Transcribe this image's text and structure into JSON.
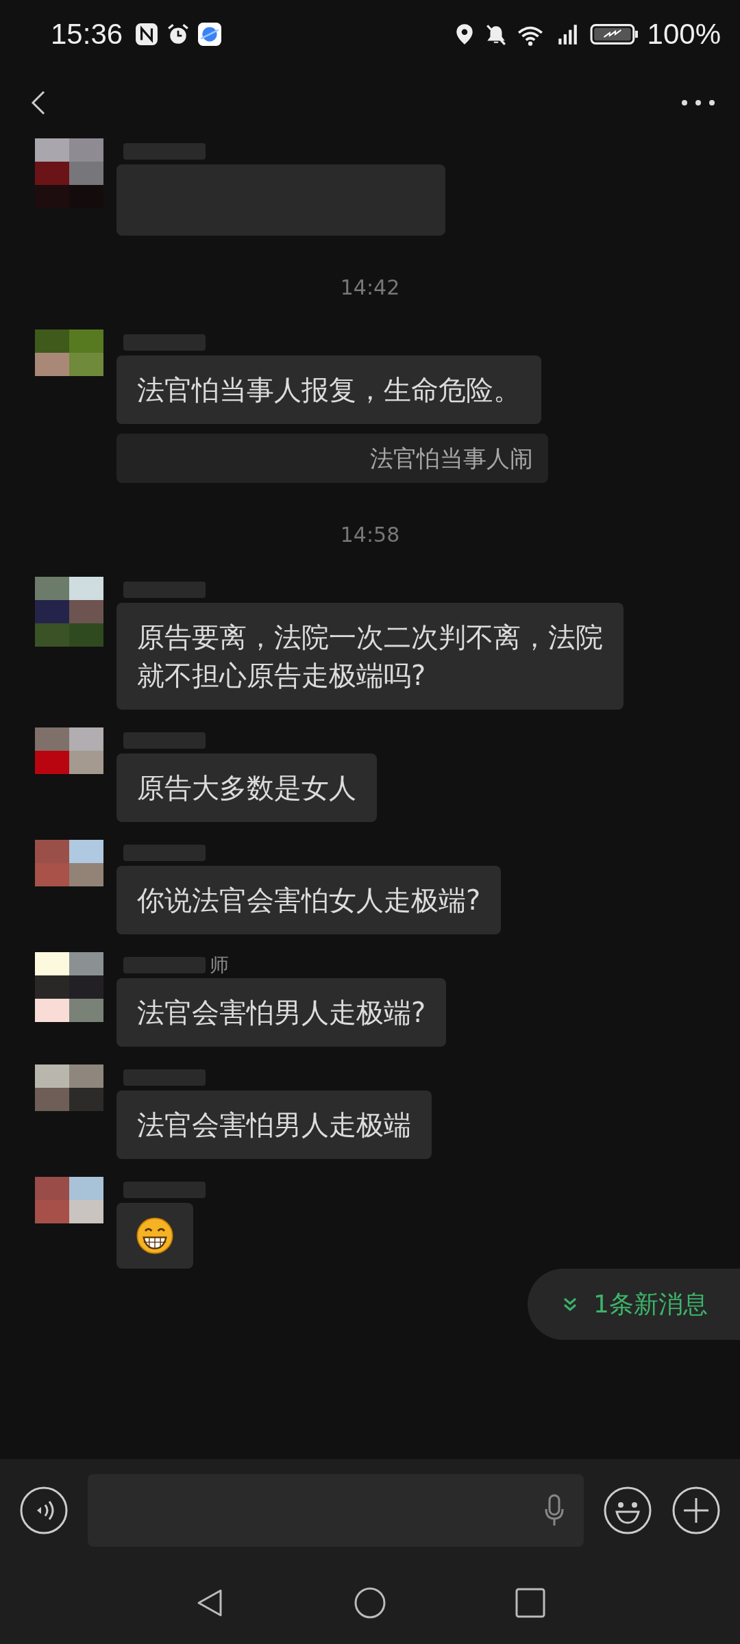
{
  "status_bar": {
    "time": "15:36",
    "battery": "100%"
  },
  "messages": [
    {
      "kind": "blurred"
    },
    {
      "kind": "time",
      "text": "14:42"
    },
    {
      "kind": "text",
      "text": "法官怕当事人报复，生命危险。",
      "quote": "法官怕当事人闹"
    },
    {
      "kind": "time",
      "text": "14:58"
    },
    {
      "kind": "text",
      "text": "原告要离，法院一次二次判不离，法院就不担心原告走极端吗?"
    },
    {
      "kind": "text",
      "text": "原告大多数是女人"
    },
    {
      "kind": "text",
      "text": "你说法官会害怕女人走极端?"
    },
    {
      "kind": "text",
      "text": "法官会害怕男人走极端?",
      "name": "师"
    },
    {
      "kind": "text",
      "text": "法官会害怕男人走极端"
    },
    {
      "kind": "emoji"
    }
  ],
  "new_messages": {
    "text": "1条新消息"
  }
}
